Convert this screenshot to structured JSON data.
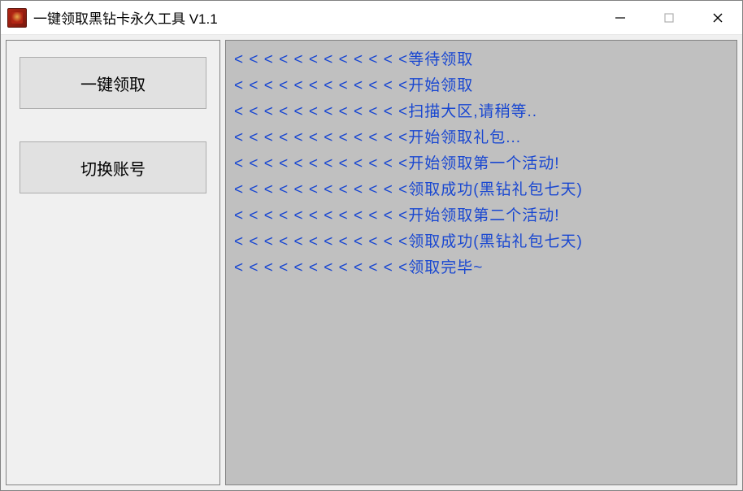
{
  "window": {
    "title": "一键领取黑钻卡永久工具 V1.1"
  },
  "buttons": {
    "claim": "一键领取",
    "switch_account": "切换账号"
  },
  "log": {
    "prefix": "< < < < < < < < < < < <",
    "lines": [
      "等待领取",
      "开始领取",
      "扫描大区,请稍等..",
      "开始领取礼包...",
      "开始领取第一个活动!",
      "领取成功(黑钻礼包七天)",
      "开始领取第二个活动!",
      "领取成功(黑钻礼包七天)",
      "领取完毕~"
    ]
  }
}
